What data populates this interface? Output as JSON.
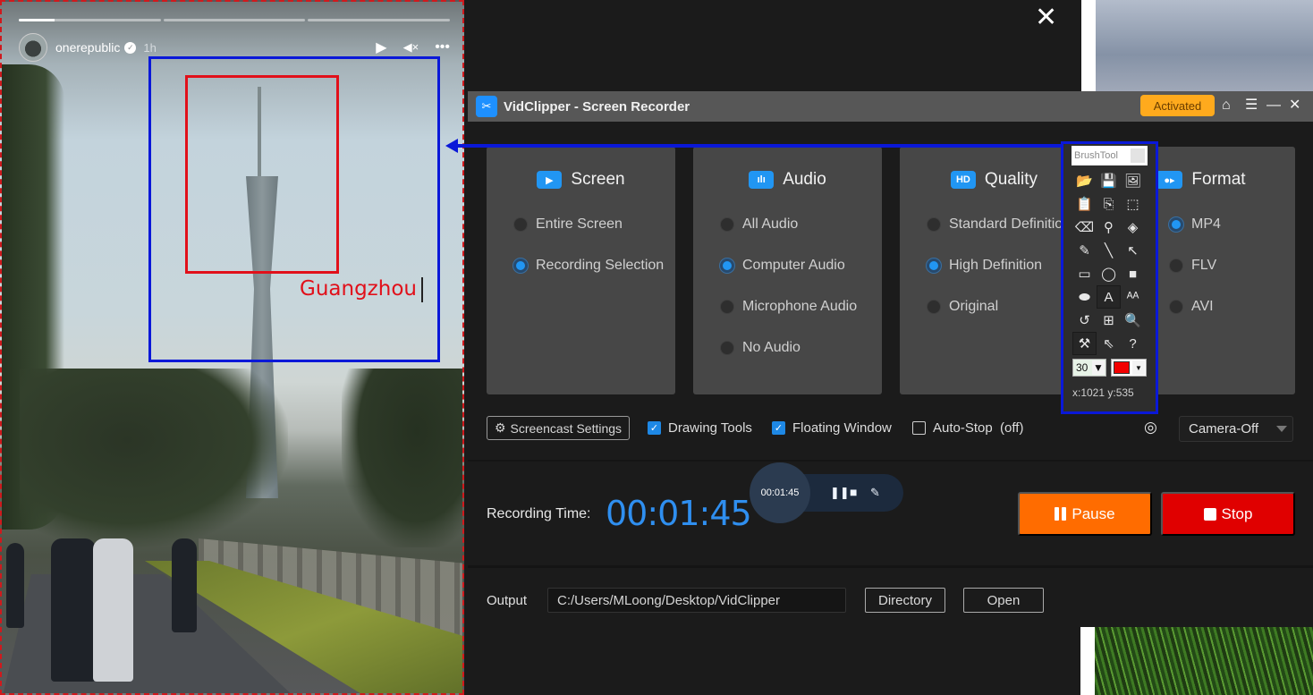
{
  "story": {
    "username": "onerepublic",
    "verified_icon": "verified-badge-icon",
    "time_ago": "1h",
    "progress_segments": [
      0.25,
      0,
      0
    ],
    "controls": [
      {
        "name": "play-icon",
        "glyph": "▶"
      },
      {
        "name": "mute-icon",
        "glyph": "🔇"
      },
      {
        "name": "more-icon",
        "glyph": "•••"
      }
    ]
  },
  "annotation": {
    "text": "Guangzhou",
    "colors": {
      "rect_outer": "#0a18d8",
      "rect_inner": "#e1101a",
      "text": "#e1101a"
    }
  },
  "backdrop": {
    "close_glyph": "✕"
  },
  "app": {
    "title": "VidClipper - Screen Recorder",
    "logo_glyph": "✂",
    "activated_label": "Activated",
    "titlebar_icons": {
      "home": "⌂",
      "menu": "☰",
      "minimize": "—",
      "close": "✕"
    },
    "cards": [
      {
        "title": "Screen",
        "icon": "▶",
        "icon_name": "screen-play-icon",
        "options": [
          {
            "label": "Entire Screen",
            "selected": false
          },
          {
            "label": "Recording Selection",
            "selected": true
          }
        ]
      },
      {
        "title": "Audio",
        "icon": "ılı",
        "icon_name": "audio-wave-icon",
        "options": [
          {
            "label": "All Audio",
            "selected": false
          },
          {
            "label": "Computer Audio",
            "selected": true
          },
          {
            "label": "Microphone Audio",
            "selected": false
          },
          {
            "label": "No Audio",
            "selected": false
          }
        ]
      },
      {
        "title": "Quality",
        "icon": "HD",
        "icon_name": "hd-icon",
        "options": [
          {
            "label": "Standard Definition",
            "selected": false
          },
          {
            "label": "High Definition",
            "selected": true
          },
          {
            "label": "Original",
            "selected": false
          }
        ]
      },
      {
        "title": "Format",
        "icon": "■◀",
        "icon_name": "video-camera-icon",
        "options": [
          {
            "label": "MP4",
            "selected": true
          },
          {
            "label": "FLV",
            "selected": false
          },
          {
            "label": "AVI",
            "selected": false
          }
        ]
      }
    ],
    "brush_tool": {
      "title": "BrushTool",
      "tools": [
        {
          "name": "open-folder-icon",
          "glyph": "📂"
        },
        {
          "name": "save-icon",
          "glyph": "💾"
        },
        {
          "name": "screenshot-icon",
          "glyph": "🖼"
        },
        {
          "name": "paste-icon",
          "glyph": "📋"
        },
        {
          "name": "copy-icon",
          "glyph": "⎘"
        },
        {
          "name": "select-rect-icon",
          "glyph": "⬚"
        },
        {
          "name": "eraser-icon",
          "glyph": "⌫"
        },
        {
          "name": "eyedropper-icon",
          "glyph": "⚲"
        },
        {
          "name": "fill-bucket-icon",
          "glyph": "◈"
        },
        {
          "name": "pencil-icon",
          "glyph": "✎"
        },
        {
          "name": "line-icon",
          "glyph": "╲"
        },
        {
          "name": "arrow-icon",
          "glyph": "↖"
        },
        {
          "name": "rectangle-icon",
          "glyph": "▭"
        },
        {
          "name": "ellipse-icon",
          "glyph": "◯"
        },
        {
          "name": "filled-rect-icon",
          "glyph": "■"
        },
        {
          "name": "filled-ellipse-icon",
          "glyph": "⬬"
        },
        {
          "name": "text-icon",
          "glyph": "A",
          "selected": true
        },
        {
          "name": "highlight-text-icon",
          "glyph": "ᴬᴬ"
        },
        {
          "name": "undo-icon",
          "glyph": "↺"
        },
        {
          "name": "whiteboard-icon",
          "glyph": "⊞"
        },
        {
          "name": "zoom-icon",
          "glyph": "🔍"
        },
        {
          "name": "brush-icon",
          "glyph": "⚒",
          "selected": true
        },
        {
          "name": "pointer-icon",
          "glyph": "⇖"
        },
        {
          "name": "help-icon",
          "glyph": "?"
        }
      ],
      "size_value": "30",
      "color_value": "#f20000",
      "coords": "x:1021  y:535"
    },
    "options_row": {
      "screencast_settings": "Screencast Settings",
      "drawing_tools": {
        "label": "Drawing Tools",
        "checked": true
      },
      "floating_window": {
        "label": "Floating Window",
        "checked": true
      },
      "auto_stop": {
        "label": "Auto-Stop  (off)",
        "checked": false
      },
      "camera_select": "Camera-Off"
    },
    "recording": {
      "label": "Recording Time:",
      "time": "00:01:45",
      "floating_time": "00:01:45",
      "pause_label": "Pause",
      "stop_label": "Stop"
    },
    "output": {
      "label": "Output",
      "path": "C:/Users/MLoong/Desktop/VidClipper",
      "directory_label": "Directory",
      "open_label": "Open"
    }
  }
}
